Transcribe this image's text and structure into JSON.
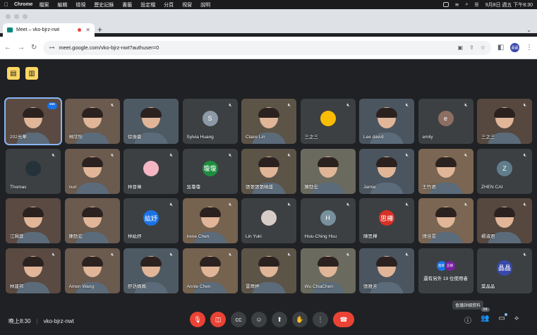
{
  "macos_menubar": {
    "app_name": "Chrome",
    "menus": [
      "檔案",
      "編輯",
      "檢視",
      "歷史記錄",
      "書籤",
      "設定檔",
      "分頁",
      "視窗",
      "說明"
    ],
    "clock": "9月8日 週五 下午8:30"
  },
  "browser": {
    "tab_title": "Meet – vko-bjrz-nwt",
    "url": "meet.google.com/vko-bjrz-nwt?authuser=0",
    "profile_initials": "晶晶"
  },
  "participants": [
    {
      "name": "202光華",
      "type": "video",
      "active": true,
      "more": true
    },
    {
      "name": "林欣怡",
      "type": "video",
      "muted": true
    },
    {
      "name": "徐振豪",
      "type": "video"
    },
    {
      "name": "Sylvia Huang",
      "type": "avatar",
      "initial": "S",
      "color": "#8d99a6",
      "muted": true
    },
    {
      "name": "Claire Lin",
      "type": "video",
      "muted": true
    },
    {
      "name": "三之三",
      "type": "avatar",
      "initial": "",
      "color": "#fbbc04",
      "muted": true
    },
    {
      "name": "Lee david",
      "type": "video",
      "muted": true
    },
    {
      "name": "emily",
      "type": "avatar",
      "initial": "e",
      "color": "#8d6e63",
      "muted": true
    },
    {
      "name": "三之三",
      "type": "video",
      "muted": true
    },
    {
      "name": "Thomas",
      "type": "avatar",
      "initial": "",
      "color": "#26323a",
      "muted": true
    },
    {
      "name": "nuri",
      "type": "video",
      "muted": true
    },
    {
      "name": "林晉琳",
      "type": "avatar",
      "initial": "",
      "color": "#f4b6c2",
      "muted": true
    },
    {
      "name": "吳瓊瓊",
      "type": "avatar",
      "initial": "瓊瓊",
      "color": "#1e8e3e",
      "muted": true
    },
    {
      "name": "張張張張曉盛",
      "type": "video",
      "muted": true
    },
    {
      "name": "陳勁宏",
      "type": "video"
    },
    {
      "name": "Jamie",
      "type": "video",
      "muted": true
    },
    {
      "name": "王竹君",
      "type": "video",
      "muted": true
    },
    {
      "name": "ZHEN CAI",
      "type": "avatar",
      "initial": "Z",
      "color": "#607d8b",
      "muted": true
    },
    {
      "name": "江珮蓉",
      "type": "video"
    },
    {
      "name": "陳勁宏",
      "type": "video"
    },
    {
      "name": "林紘妤",
      "type": "avatar",
      "initial": "紘妤",
      "color": "#1a73e8",
      "muted": true
    },
    {
      "name": "irene Chen",
      "type": "video",
      "muted": true
    },
    {
      "name": "Lin Yuki",
      "type": "avatar",
      "initial": "",
      "color": "#d7ccc8",
      "muted": true
    },
    {
      "name": "Hsiu-Ching Hsu",
      "type": "avatar",
      "initial": "H",
      "color": "#78909c",
      "muted": true
    },
    {
      "name": "陳思樺",
      "type": "avatar",
      "initial": "思樺",
      "color": "#d93025",
      "muted": true
    },
    {
      "name": "傅佳雯",
      "type": "video",
      "muted": true
    },
    {
      "name": "楊淑君",
      "type": "video",
      "muted": true
    },
    {
      "name": "林建邦",
      "type": "video",
      "muted": true
    },
    {
      "name": "Amen Wang",
      "type": "video",
      "muted": true
    },
    {
      "name": "舒語媽媽",
      "type": "video",
      "muted": true
    },
    {
      "name": "Annie Chen",
      "type": "video",
      "muted": true
    },
    {
      "name": "雷晴婷",
      "type": "video",
      "muted": true
    },
    {
      "name": "Wu ChiaChen",
      "type": "video",
      "muted": true
    },
    {
      "name": "張雅芳",
      "type": "video",
      "muted": true
    },
    {
      "name": "還有另外 19 位使用者",
      "type": "others",
      "chips": [
        "富舜",
        "又靖"
      ]
    },
    {
      "name": "葉晶晶",
      "type": "avatar",
      "initial": "晶晶",
      "color": "#3949ab",
      "muted": true
    }
  ],
  "footer": {
    "time": "晚上8:30",
    "meeting_code": "vko-bjrz-nwt",
    "tooltip": "會議詳細資料",
    "participant_count": "54"
  }
}
